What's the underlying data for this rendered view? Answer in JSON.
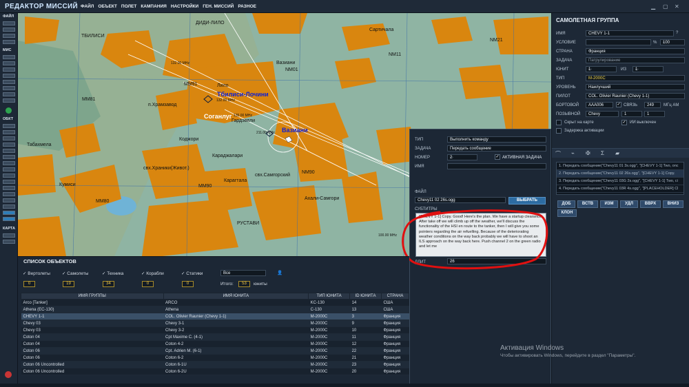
{
  "app_title": "РЕДАКТОР МИССИЙ",
  "menu": [
    "ФАЙЛ",
    "ОБЪЕКТ",
    "ПОЛЕТ",
    "КАМПАНИЯ",
    "НАСТРОЙКИ",
    "ГЕН. МИССИЙ",
    "РАЗНОЕ"
  ],
  "left_toolbar": {
    "file": "ФАЙЛ",
    "mis": "МИС",
    "obj": "ОБКТ",
    "map": "КАРТА"
  },
  "map_labels": {
    "didi_lilo": "ДИДИ-ЛИЛО",
    "tbilisi": "ТБИЛИСИ",
    "sartichala": "Сартичала",
    "nm21": "NM21",
    "nm11": "NM11",
    "vaziani_town": "Вазиани",
    "nm01": "NM01",
    "mm91": "MM91",
    "lilo": "Лило",
    "tbilisi_lochini": "Тбилиси-Лочини",
    "mm81": "MM81",
    "khramsaw": "п.Храмзавод",
    "soganlug": "Соганлуг",
    "gardjveli": "Гардэвели",
    "vaziani_ab": "Вазиани",
    "tabakhmela": "Табахмела",
    "kojori": "Коджори",
    "karadzhalari": "Караджалари",
    "kraniki": "свх.Храники(Живот.)",
    "mm90": "MM90",
    "karagtala": "Карагтала",
    "samgorsky": "свх.Самгорский",
    "nm90": "NM90",
    "kumisi": "Кумиси",
    "mm80": "MM80",
    "akhali_samgori": "Ахали-Самгори",
    "rustavi": "РУСТАВИ",
    "freq1": "132.00 MHz",
    "freq2": "132.00 MHz",
    "freq3": "135.00 MHz",
    "freq4": "211.00 MHz",
    "freq5": "100.00 MHz"
  },
  "group_panel": {
    "title": "САМОЛЕТНАЯ ГРУППА",
    "name_label": "ИМЯ",
    "name_value": "CHEVY 1-1",
    "condition_label": "УСЛОВИЕ",
    "percent": "%",
    "condition_pct": "100",
    "country_label": "СТРАНА",
    "country_value": "Франция",
    "task_label": "ЗАДАЧА",
    "task_value": "Патрулирование",
    "unit_label": "ЮНИТ",
    "unit_value": "1",
    "of_label": "ИЗ",
    "of_value": "1",
    "type_label": "ТИП",
    "type_value": "M-2000C",
    "level_label": "УРОВЕНЬ",
    "level_value": "Наилучший",
    "pilot_label": "ПИЛОТ",
    "pilot_value": "COL. Olivier Raunier (Chevy 1-1)",
    "board_label": "БОРТОВОЙ",
    "board_value": "AAA006",
    "comm_label": "СВЯЗЬ",
    "comm_value": "249",
    "comm_unit": "МГц АМ",
    "callsign_label": "ПОЗЫВНОЙ",
    "callsign_value": "Chevy",
    "callsign_n1": "1",
    "callsign_n2": "1",
    "hidden_label": "Скрыт на карте",
    "ai_off_label": "ИИ выключен",
    "delay_label": "Задержка активации"
  },
  "action_list": [
    "1. Передать сообщение(\"Chevy11 01 3s.ogg\", \"[CHEVY 1-1] Two, onc",
    "2. Передать сообщение(\"Chevy11 02 26s.ogg\", \"[CHEVY 1-1] Copy.",
    "3. Передать сообщение(\"Chevy11 03G 2s.ogg\", \"[CHEVY 1-1] Two, ci",
    "4. Передать сообщение(\"Chevy11 03R 4s.ogg\", \"[PLACEHOLDER] Cl"
  ],
  "action_buttons": [
    "ДОБ",
    "ВСТВ",
    "ИЗМ",
    "УДЛ",
    "ВВРХ",
    "ВНИЗ",
    "КЛОН"
  ],
  "action_popup": {
    "type_label": "ТИП",
    "type_value": "Выполнить команду",
    "task_label": "ЗАДАЧА",
    "task_value": "Передать сообщение",
    "number_label": "НОМЕР",
    "number_value": "2",
    "active_label": "АКТИВНАЯ ЗАДАЧА",
    "name_label": "ИМЯ",
    "name_value": "",
    "file_label": "ФАЙЛ",
    "file_value": "Chevy11 02 26s.ogg",
    "choose_btn": "ВЫБРАТЬ",
    "subs_label": "СУБТИТРЫ",
    "subs_text": "[CHEVY 1-1] Copy. Good! Here's the plan. We have a startup clearance. After take off we will climb up off the weather, we'll discuss the functionality of the HSI en route to the tanker, then I will give you some pointers regarding the air refuelling. Because of the deteriorating weather conditions on the way back probably we will have to shoot an ILS approach on the way back here. Push channel 2 on the green radio and let me",
    "dur_label": "ДЛИТ",
    "dur_value": "26"
  },
  "object_list": {
    "title": "СПИСОК ОБЪЕКТОВ",
    "filters": [
      "Вертолеты",
      "Самолеты",
      "Техника",
      "Корабли",
      "Статики"
    ],
    "counts": [
      "0",
      "19",
      "34",
      "0",
      "0"
    ],
    "all": "Все",
    "total_label": "Итого:",
    "total_value": "53",
    "total_unit": "юниты",
    "headers": [
      "ИМЯ ГРУППЫ",
      "ИМЯ ЮНИТА",
      "ТИП ЮНИТА",
      "ID ЮНИТА",
      "СТРАНА"
    ],
    "rows": [
      [
        "Arco [Tanker]",
        "ARCO",
        "KC-130",
        "14",
        "США"
      ],
      [
        "Athena (EC-130)",
        "Athena",
        "C-130",
        "13",
        "США"
      ],
      [
        "CHEVY 1-1",
        "COL. Olivier Raunier (Chevy 1-1)",
        "M-2000C",
        "3",
        "Франция"
      ],
      [
        "Chevy 03",
        "Chevy 3-1",
        "M-2000C",
        "9",
        "Франция"
      ],
      [
        "Chevy 03",
        "Chevy 3-2",
        "M-2000C",
        "10",
        "Франция"
      ],
      [
        "Coton 04",
        "Cpt Maxime C. (4-1)",
        "M-2000C",
        "11",
        "Франция"
      ],
      [
        "Coton 04",
        "Coton 4-2",
        "M-2000C",
        "12",
        "Франция"
      ],
      [
        "Coton 06",
        "Cpt. Adrien M. (6-1)",
        "M-2000C",
        "22",
        "Франция"
      ],
      [
        "Coton 06",
        "Coton 6-2",
        "M-2000C",
        "21",
        "Франция"
      ],
      [
        "Coton 06 Uncontrolled",
        "Coton 6-1U",
        "M-2000C",
        "23",
        "Франция"
      ],
      [
        "Coton 06 Uncontrolled",
        "Coton 6-2U",
        "M-2000C",
        "20",
        "Франция"
      ]
    ]
  },
  "windows_activation": {
    "line1": "Активация Windows",
    "line2": "Чтобы активировать Windows, перейдите в раздел \"Параметры\"."
  },
  "colors": {
    "accent": "#2d6ca2",
    "highlight_red": "#e01010",
    "terrain_orange": "#d9860f",
    "map_green": "#88b0a0"
  }
}
